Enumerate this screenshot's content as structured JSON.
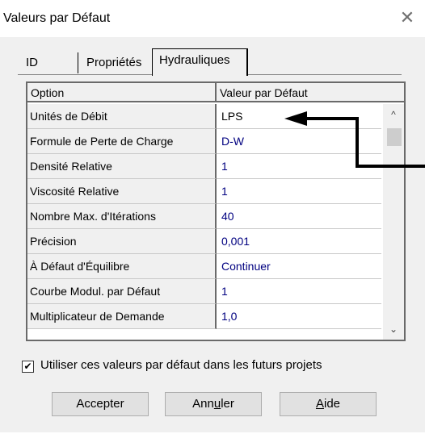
{
  "window": {
    "title": "Valeurs par Défaut",
    "close_glyph": "✕"
  },
  "tabs": [
    {
      "label": "ID"
    },
    {
      "label": "Propriétés"
    },
    {
      "label": "Hydrauliques",
      "selected": true
    }
  ],
  "grid": {
    "header_option": "Option",
    "header_value": "Valeur par Défaut",
    "rows": [
      {
        "option": "Unités de Débit",
        "value": "LPS"
      },
      {
        "option": "Formule de Perte de Charge",
        "value": "D-W"
      },
      {
        "option": "Densité Relative",
        "value": "1"
      },
      {
        "option": "Viscosité Relative",
        "value": "1"
      },
      {
        "option": "Nombre Max. d'Itérations",
        "value": "40"
      },
      {
        "option": "Précision",
        "value": "0,001"
      },
      {
        "option": "À Défaut d'Équilibre",
        "value": "Continuer"
      },
      {
        "option": "Courbe Modul. par Défaut",
        "value": "1"
      },
      {
        "option": "Multiplicateur de Demande",
        "value": "1,0"
      }
    ]
  },
  "scrollbar": {
    "up_glyph": "^",
    "down_glyph": "⌄"
  },
  "checkbox": {
    "checked": true,
    "mark": "✔",
    "label": "Utiliser ces valeurs par défaut dans les futurs projets"
  },
  "buttons": {
    "accept": "Accepter",
    "cancel_prefix": "Ann",
    "cancel_underlined": "u",
    "cancel_suffix": "ler",
    "help_underlined": "A",
    "help_suffix": "ide"
  }
}
